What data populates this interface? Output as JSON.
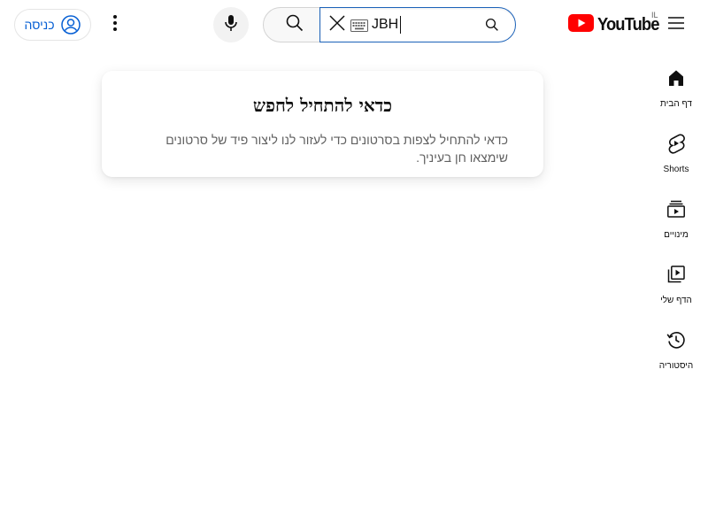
{
  "header": {
    "logo_text": "YouTube",
    "country_code": "IL",
    "search": {
      "value": "JBH",
      "placeholder": ""
    },
    "signin_label": "כניסה",
    "icons": [
      "hamburger-menu-icon",
      "youtube-logo-icon",
      "search-icon",
      "keyboard-icon",
      "clear-icon",
      "microphone-icon",
      "more-vertical-icon",
      "account-circle-icon"
    ],
    "colors": {
      "brand_red": "#FF0000",
      "link_blue": "#065fd4",
      "search_focus_border": "#1c62b9"
    }
  },
  "sidebar": {
    "items": [
      {
        "label": "דף הבית",
        "icon": "home-icon"
      },
      {
        "label": "Shorts",
        "icon": "shorts-icon"
      },
      {
        "label": "מינויים",
        "icon": "subscriptions-icon"
      },
      {
        "label": "הדף שלי",
        "icon": "library-icon"
      },
      {
        "label": "היסטוריה",
        "icon": "history-icon"
      }
    ]
  },
  "main": {
    "prompt_title": "כדאי להתחיל לחפש",
    "prompt_body": "כדאי להתחיל לצפות בסרטונים כדי לעזור לנו ליצור פיד של סרטונים שימצאו חן בעיניך."
  }
}
